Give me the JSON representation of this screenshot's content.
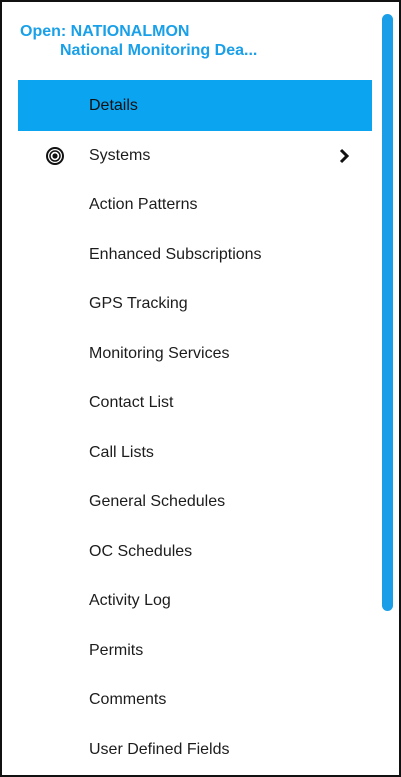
{
  "header": {
    "line1": "Open: NATIONALMON",
    "line2": "National Monitoring Dea..."
  },
  "menu": {
    "items": [
      {
        "label": "Details",
        "selected": true
      },
      {
        "label": "Systems",
        "icon": "radio-target-icon",
        "has_submenu": true
      },
      {
        "label": "Action Patterns"
      },
      {
        "label": "Enhanced Subscriptions"
      },
      {
        "label": "GPS Tracking"
      },
      {
        "label": "Monitoring Services"
      },
      {
        "label": "Contact List"
      },
      {
        "label": "Call Lists"
      },
      {
        "label": "General Schedules"
      },
      {
        "label": "OC Schedules"
      },
      {
        "label": "Activity Log"
      },
      {
        "label": "Permits"
      },
      {
        "label": "Comments"
      },
      {
        "label": "User Defined Fields"
      }
    ]
  },
  "colors": {
    "accent": "#0ba4f1",
    "header_text": "#1aa0e8",
    "scrollbar": "#1a9ee8"
  }
}
